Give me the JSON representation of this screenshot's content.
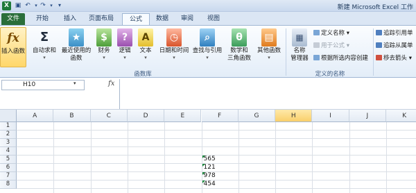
{
  "title_bar": {
    "app_icon": "X",
    "window_title": "新建 Microsoft Excel 工作"
  },
  "tabs": [
    {
      "label": "文件"
    },
    {
      "label": "开始"
    },
    {
      "label": "插入"
    },
    {
      "label": "页面布局"
    },
    {
      "label": "公式"
    },
    {
      "label": "数据"
    },
    {
      "label": "审阅"
    },
    {
      "label": "视图"
    }
  ],
  "ribbon": {
    "function_library": {
      "insert_function": "插入函数",
      "autosum": "自动求和",
      "recently_used_1": "最近使用的",
      "recently_used_2": "函数",
      "financial": "财务",
      "logical": "逻辑",
      "text": "文本",
      "date_time": "日期和时间",
      "lookup_reference": "查找与引用",
      "math_trig_1": "数学和",
      "math_trig_2": "三角函数",
      "more_functions": "其他函数",
      "group_label": "函数库"
    },
    "defined_names": {
      "name_manager_1": "名称",
      "name_manager_2": "管理器",
      "define_name": "定义名称",
      "use_in_formula": "用于公式",
      "create_from_selection": "根据所选内容创建",
      "group_label": "定义的名称"
    },
    "formula_auditing": {
      "trace_precedents": "追踪引用单",
      "trace_dependents": "追踪从属单",
      "remove_arrows": "移去箭头"
    }
  },
  "formula_bar": {
    "name_box": "H10",
    "fx": "fx",
    "content": ""
  },
  "sheet": {
    "columns": [
      "A",
      "B",
      "C",
      "D",
      "E",
      "F",
      "G",
      "H",
      "I",
      "J",
      "K"
    ],
    "selected_column": "H",
    "rows": [
      "1",
      "2",
      "3",
      "4",
      "5",
      "6",
      "7",
      "8"
    ],
    "cells": {
      "F5": "565",
      "F6": "121",
      "F7": "978",
      "F8": "454"
    }
  },
  "colors": {
    "file_tab": "#2a6e3a",
    "excel_green": "#1f7a3a",
    "selected_header": "#f9cf6a",
    "number_error_marker": "#1a8a3b"
  }
}
